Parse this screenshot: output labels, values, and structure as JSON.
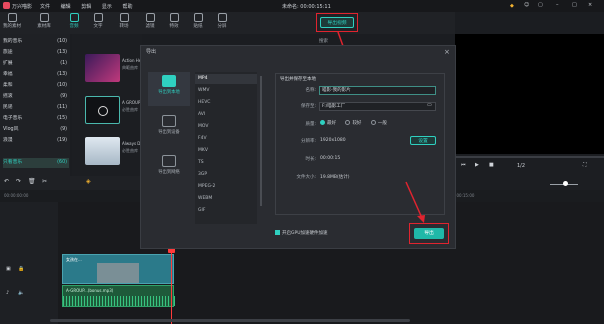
{
  "app": {
    "name": "万兴喵影",
    "menu": [
      "文件",
      "编辑",
      "剪辑",
      "显示",
      "帮助"
    ],
    "project": "未命名: 00:00:15:11"
  },
  "toolbar": {
    "items": [
      "我的素材",
      "素材库",
      "音频",
      "文字",
      "转场",
      "滤镜",
      "特效",
      "贴纸",
      "分屏"
    ]
  },
  "export_button": "导出视频",
  "sidebar": {
    "items": [
      {
        "label": "我的音乐",
        "count": "(10)"
      },
      {
        "label": "旅途",
        "count": "(13)"
      },
      {
        "label": "扩展",
        "count": "(1)"
      },
      {
        "label": "幸福",
        "count": "(13)"
      },
      {
        "label": "柔和",
        "count": "(10)"
      },
      {
        "label": "摇滚",
        "count": "(9)"
      },
      {
        "label": "民谣",
        "count": "(11)"
      },
      {
        "label": "电子音乐",
        "count": "(15)"
      },
      {
        "label": "Vlog风",
        "count": "(9)"
      },
      {
        "label": "浪漫",
        "count": "(19)"
      },
      {
        "label": "只看音乐",
        "count": "(60)"
      }
    ]
  },
  "media": [
    {
      "title": "Action He...",
      "sub": "典範曲库"
    },
    {
      "title": "A GROUP...",
      "sub": "必胜曲库"
    },
    {
      "title": "Always Dr...",
      "sub": "必胜曲库"
    }
  ],
  "dialog": {
    "title": "导出",
    "targets": [
      "导出到本地",
      "导出到设备",
      "导出到网络"
    ],
    "formats": [
      "MP4",
      "WMV",
      "HEVC",
      "AVI",
      "MOV",
      "F4V",
      "MKV",
      "TS",
      "3GP",
      "MPEG-2",
      "WEBM",
      "GIF"
    ],
    "selected_format": "MP4",
    "settings_title": "导出并保存至本地",
    "name_label": "名称:",
    "name_value": "喵影-我的影片",
    "path_label": "保存至:",
    "path_value": "F:/喵影工厂",
    "quality_label": "质量:",
    "quality_options": [
      "最好",
      "较好",
      "一般"
    ],
    "resolution_label": "分辨率:",
    "resolution_value": "1920x1080",
    "settings_button": "设置",
    "duration_label": "时长:",
    "duration_value": "00:00:15",
    "size_label": "文件大小:",
    "size_value": "19.8MB(估计)",
    "gpu_label": "开启GPU加速硬件加速",
    "export_label": "导出",
    "search_placeholder": "搜索"
  },
  "preview": {
    "page": "1/2"
  },
  "timeline": {
    "times": [
      "00:00:00:00",
      "00:00:05:00",
      "00:00:10:00",
      "00:00:15:00"
    ],
    "clips": [
      "女孩在...",
      "A-GROUP...(bonus.mp3)"
    ]
  },
  "colors": {
    "accent": "#2fd0c0",
    "highlight": "#e0242f",
    "teal_button": "#1fb8a8"
  }
}
